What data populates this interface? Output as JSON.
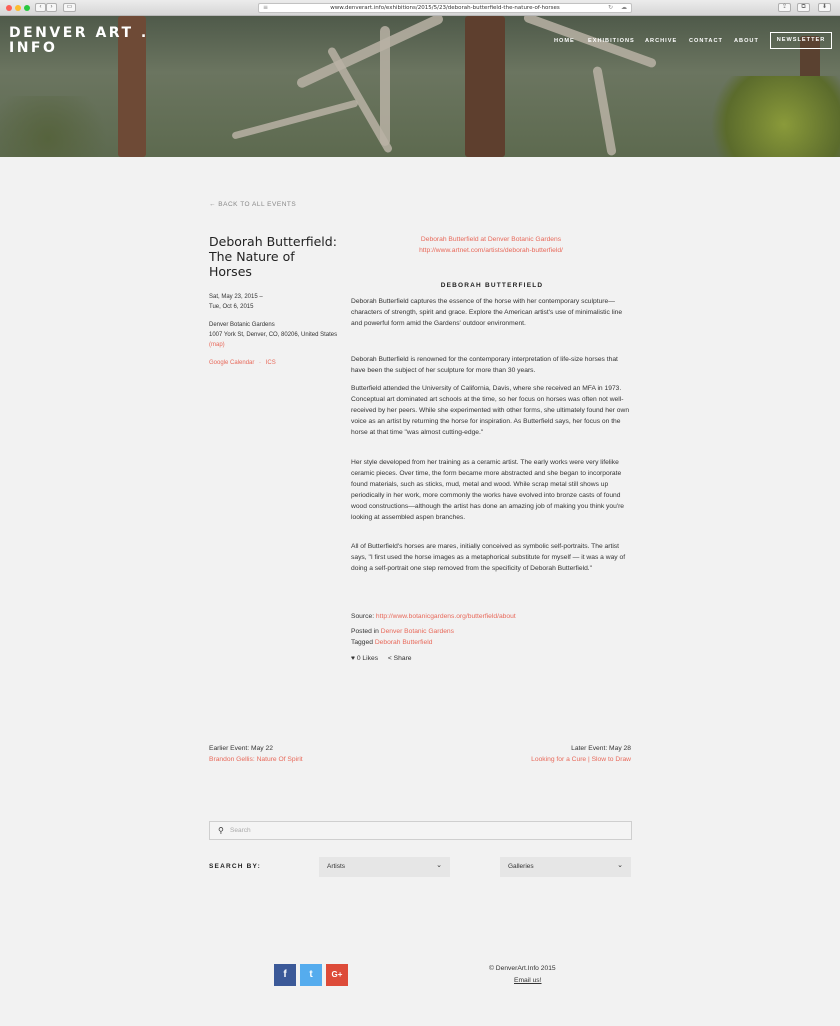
{
  "browser": {
    "url": "www.denverart.info/exhibitions/2015/5/23/deborah-butterfield-the-nature-of-horses"
  },
  "site": {
    "logo_line1": "DENVER ART .",
    "logo_line2": "INFO",
    "nav": [
      "HOME",
      "EXHIBITIONS",
      "ARCHIVE",
      "CONTACT",
      "ABOUT"
    ],
    "newsletter": "NEWSLETTER"
  },
  "event": {
    "back_link": "← BACK TO ALL EVENTS",
    "title": "Deborah Butterfield: The Nature of Horses",
    "date_line1": "Sat, May 23, 2015 –",
    "date_line2": "Tue, Oct 6, 2015",
    "venue": "Denver Botanic Gardens",
    "address": "1007 York St, Denver, CO, 80206, United States",
    "map_link": "(map)",
    "gcal": "Google Calendar",
    "sep": "·",
    "ics": "ICS"
  },
  "content": {
    "link1": "Deborah Butterfield at Denver Botanic Gardens",
    "link2": "http://www.artnet.com/artists/deborah-butterfield/",
    "heading": "DEBORAH BUTTERFIELD",
    "p1": "Deborah Butterfield captures the essence of the horse with her contemporary sculpture—characters of strength, spirit and grace. Explore the American artist's use of minimalistic line and powerful form amid the Gardens' outdoor environment.",
    "p2": "Deborah Butterfield is renowned for the contemporary interpretation of life-size horses that have been the subject of her sculpture for more than 30 years.",
    "p3": "Butterfield attended the University of California, Davis, where she received an MFA in 1973. Conceptual art dominated art schools at the time, so her focus on horses was often not well-received by her peers. While she experimented with other forms, she ultimately found her own voice as an artist by returning the horse for inspiration. As Butterfield says, her focus on the horse at that time \"was almost cutting-edge.\"",
    "p4": "Her style developed from her training as a ceramic artist. The early works were very lifelike ceramic pieces. Over time, the form became more abstracted and she began to incorporate found materials, such as sticks, mud, metal and wood. While scrap metal still shows up periodically in her work, more commonly the works have evolved into bronze casts of found wood constructions—although the artist has done an amazing job of making you think you're looking at assembled aspen branches.",
    "p5": "All of Butterfield's horses are mares, initially conceived as symbolic self-portraits. The artist says, \"I first used the horse images as a metaphorical substitute for myself — it was a way of doing a self-portrait one step removed from the specificity of Deborah Butterfield.\"",
    "source_label": "Source:",
    "source_url": "http://www.botanicgardens.org/butterfield/about",
    "posted_label": "Posted in",
    "posted_value": "Denver Botanic Gardens",
    "tagged_label": "Tagged",
    "tagged_value": "Deborah Butterfield",
    "likes": "0 Likes",
    "share": "Share"
  },
  "pager": {
    "earlier_label": "Earlier Event: May 22",
    "earlier_title": "Brandon Gellis: Nature Of Spirit",
    "later_label": "Later Event: May 28",
    "later_title": "Looking for a Cure | Slow to Draw"
  },
  "search": {
    "placeholder": "Search",
    "search_by": "SEARCH BY:",
    "select1": "Artists",
    "select2": "Galleries"
  },
  "footer": {
    "copyright": "©  DenverArt.Info  2015",
    "email": "Email us!",
    "social": [
      "f",
      "t",
      "G+"
    ],
    "social_colors": [
      "#3b5998",
      "#55acee",
      "#dd4b39"
    ]
  }
}
